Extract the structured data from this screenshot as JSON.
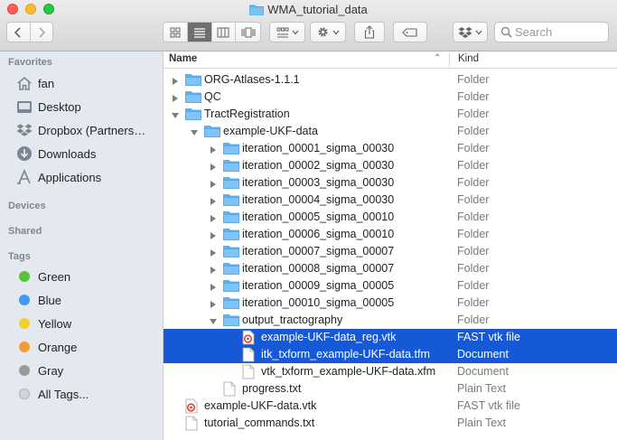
{
  "window": {
    "title": "WMA_tutorial_data"
  },
  "toolbar": {
    "search_placeholder": "Search"
  },
  "sidebar": {
    "favorites_heading": "Favorites",
    "favorites": [
      {
        "label": "fan",
        "icon": "home-icon"
      },
      {
        "label": "Desktop",
        "icon": "desktop-icon"
      },
      {
        "label": "Dropbox (Partners…",
        "icon": "dropbox-icon"
      },
      {
        "label": "Downloads",
        "icon": "downloads-icon"
      },
      {
        "label": "Applications",
        "icon": "applications-icon"
      }
    ],
    "devices_heading": "Devices",
    "shared_heading": "Shared",
    "tags_heading": "Tags",
    "tags": [
      {
        "label": "Green",
        "color": "#5ac13c"
      },
      {
        "label": "Blue",
        "color": "#3e9bf0"
      },
      {
        "label": "Yellow",
        "color": "#f5cd2e"
      },
      {
        "label": "Orange",
        "color": "#f59a34"
      },
      {
        "label": "Gray",
        "color": "#9a9a9a"
      },
      {
        "label": "All Tags...",
        "color": ""
      }
    ]
  },
  "columns": {
    "name": "Name",
    "kind": "Kind"
  },
  "rows": [
    {
      "name": "ORG-Atlases-1.1.1",
      "kind": "Folder",
      "type": "folder",
      "level": 0,
      "disclosure": "collapsed",
      "selected": false
    },
    {
      "name": "QC",
      "kind": "Folder",
      "type": "folder",
      "level": 0,
      "disclosure": "collapsed",
      "selected": false
    },
    {
      "name": "TractRegistration",
      "kind": "Folder",
      "type": "folder",
      "level": 0,
      "disclosure": "expanded",
      "selected": false
    },
    {
      "name": "example-UKF-data",
      "kind": "Folder",
      "type": "folder",
      "level": 1,
      "disclosure": "expanded",
      "selected": false
    },
    {
      "name": "iteration_00001_sigma_00030",
      "kind": "Folder",
      "type": "folder",
      "level": 2,
      "disclosure": "collapsed",
      "selected": false
    },
    {
      "name": "iteration_00002_sigma_00030",
      "kind": "Folder",
      "type": "folder",
      "level": 2,
      "disclosure": "collapsed",
      "selected": false
    },
    {
      "name": "iteration_00003_sigma_00030",
      "kind": "Folder",
      "type": "folder",
      "level": 2,
      "disclosure": "collapsed",
      "selected": false
    },
    {
      "name": "iteration_00004_sigma_00030",
      "kind": "Folder",
      "type": "folder",
      "level": 2,
      "disclosure": "collapsed",
      "selected": false
    },
    {
      "name": "iteration_00005_sigma_00010",
      "kind": "Folder",
      "type": "folder",
      "level": 2,
      "disclosure": "collapsed",
      "selected": false
    },
    {
      "name": "iteration_00006_sigma_00010",
      "kind": "Folder",
      "type": "folder",
      "level": 2,
      "disclosure": "collapsed",
      "selected": false
    },
    {
      "name": "iteration_00007_sigma_00007",
      "kind": "Folder",
      "type": "folder",
      "level": 2,
      "disclosure": "collapsed",
      "selected": false
    },
    {
      "name": "iteration_00008_sigma_00007",
      "kind": "Folder",
      "type": "folder",
      "level": 2,
      "disclosure": "collapsed",
      "selected": false
    },
    {
      "name": "iteration_00009_sigma_00005",
      "kind": "Folder",
      "type": "folder",
      "level": 2,
      "disclosure": "collapsed",
      "selected": false
    },
    {
      "name": "iteration_00010_sigma_00005",
      "kind": "Folder",
      "type": "folder",
      "level": 2,
      "disclosure": "collapsed",
      "selected": false
    },
    {
      "name": "output_tractography",
      "kind": "Folder",
      "type": "folder",
      "level": 2,
      "disclosure": "expanded",
      "selected": false
    },
    {
      "name": "example-UKF-data_reg.vtk",
      "kind": "FAST vtk file",
      "type": "vtk",
      "level": 3,
      "disclosure": "none",
      "selected": true
    },
    {
      "name": "itk_txform_example-UKF-data.tfm",
      "kind": "Document",
      "type": "doc",
      "level": 3,
      "disclosure": "none",
      "selected": true
    },
    {
      "name": "vtk_txform_example-UKF-data.xfm",
      "kind": "Document",
      "type": "doc",
      "level": 3,
      "disclosure": "none",
      "selected": false
    },
    {
      "name": "progress.txt",
      "kind": "Plain Text",
      "type": "doc",
      "level": 2,
      "disclosure": "none",
      "selected": false
    },
    {
      "name": "example-UKF-data.vtk",
      "kind": "FAST vtk file",
      "type": "vtk",
      "level": 0,
      "disclosure": "none",
      "selected": false
    },
    {
      "name": "tutorial_commands.txt",
      "kind": "Plain Text",
      "type": "doc",
      "level": 0,
      "disclosure": "none",
      "selected": false
    }
  ]
}
